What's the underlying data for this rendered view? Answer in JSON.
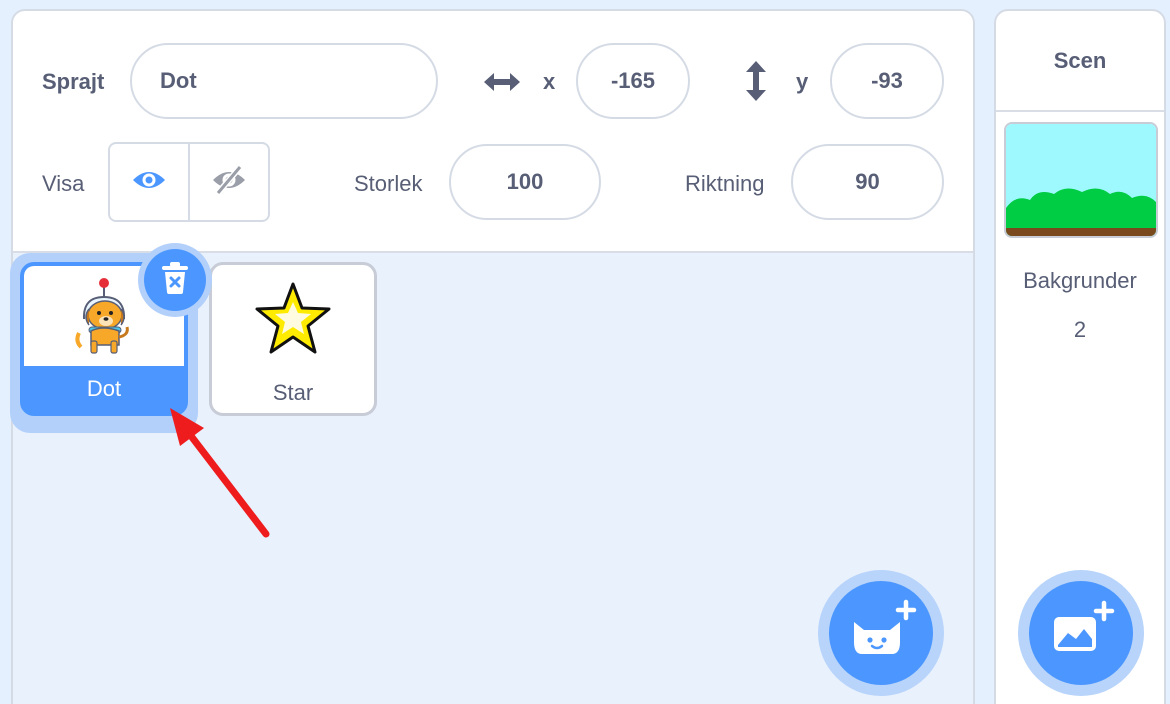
{
  "sprite_info": {
    "sprite_label": "Sprajt",
    "sprite_name": "Dot",
    "x_label": "x",
    "x_value": "-165",
    "y_label": "y",
    "y_value": "-93",
    "show_label": "Visa",
    "size_label": "Storlek",
    "size_value": "100",
    "direction_label": "Riktning",
    "direction_value": "90"
  },
  "sprites": [
    {
      "name": "Dot",
      "selected": true
    },
    {
      "name": "Star",
      "selected": false
    }
  ],
  "stage": {
    "title": "Scen",
    "backdrops_label": "Bakgrunder",
    "backdrops_count": "2"
  },
  "icons": {
    "x_icon": "horizontal-arrows-icon",
    "y_icon": "vertical-arrows-icon",
    "show": "eye-icon",
    "hide": "eye-slash-icon",
    "delete": "trash-icon",
    "add_sprite": "cat-plus-icon",
    "add_backdrop": "image-plus-icon"
  },
  "colors": {
    "accent": "#4c97ff",
    "text": "#575e75",
    "annotation_arrow": "#ee1c1c"
  }
}
